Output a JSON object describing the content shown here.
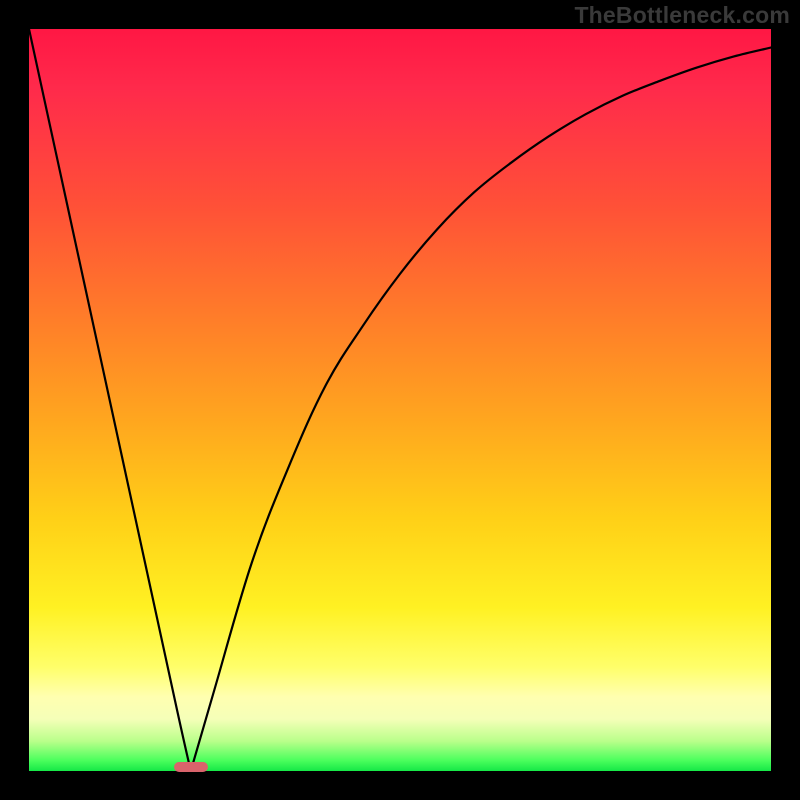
{
  "watermark": "TheBottleneck.com",
  "chart_data": {
    "type": "line",
    "title": "",
    "xlabel": "",
    "ylabel": "",
    "xlim": [
      0,
      100
    ],
    "ylim": [
      0,
      100
    ],
    "grid": false,
    "series": [
      {
        "name": "bottleneck-curve",
        "x": [
          0,
          5,
          10,
          15,
          20,
          21.8,
          25,
          30,
          35,
          40,
          45,
          50,
          55,
          60,
          65,
          70,
          75,
          80,
          85,
          90,
          95,
          100
        ],
        "values": [
          100,
          77,
          54,
          31,
          8,
          0,
          11,
          28,
          41,
          52,
          60,
          67,
          73,
          78,
          82,
          85.5,
          88.5,
          91,
          93,
          94.8,
          96.3,
          97.5
        ]
      }
    ],
    "annotations": [
      {
        "name": "optimal-marker",
        "x": 21.8,
        "y": 0,
        "color": "#d9636b"
      }
    ],
    "gradient_stops": [
      {
        "pos": 0,
        "color": "#ff1744"
      },
      {
        "pos": 24,
        "color": "#ff5137"
      },
      {
        "pos": 52,
        "color": "#ffa41f"
      },
      {
        "pos": 78,
        "color": "#fff123"
      },
      {
        "pos": 100,
        "color": "#15e847"
      }
    ]
  }
}
